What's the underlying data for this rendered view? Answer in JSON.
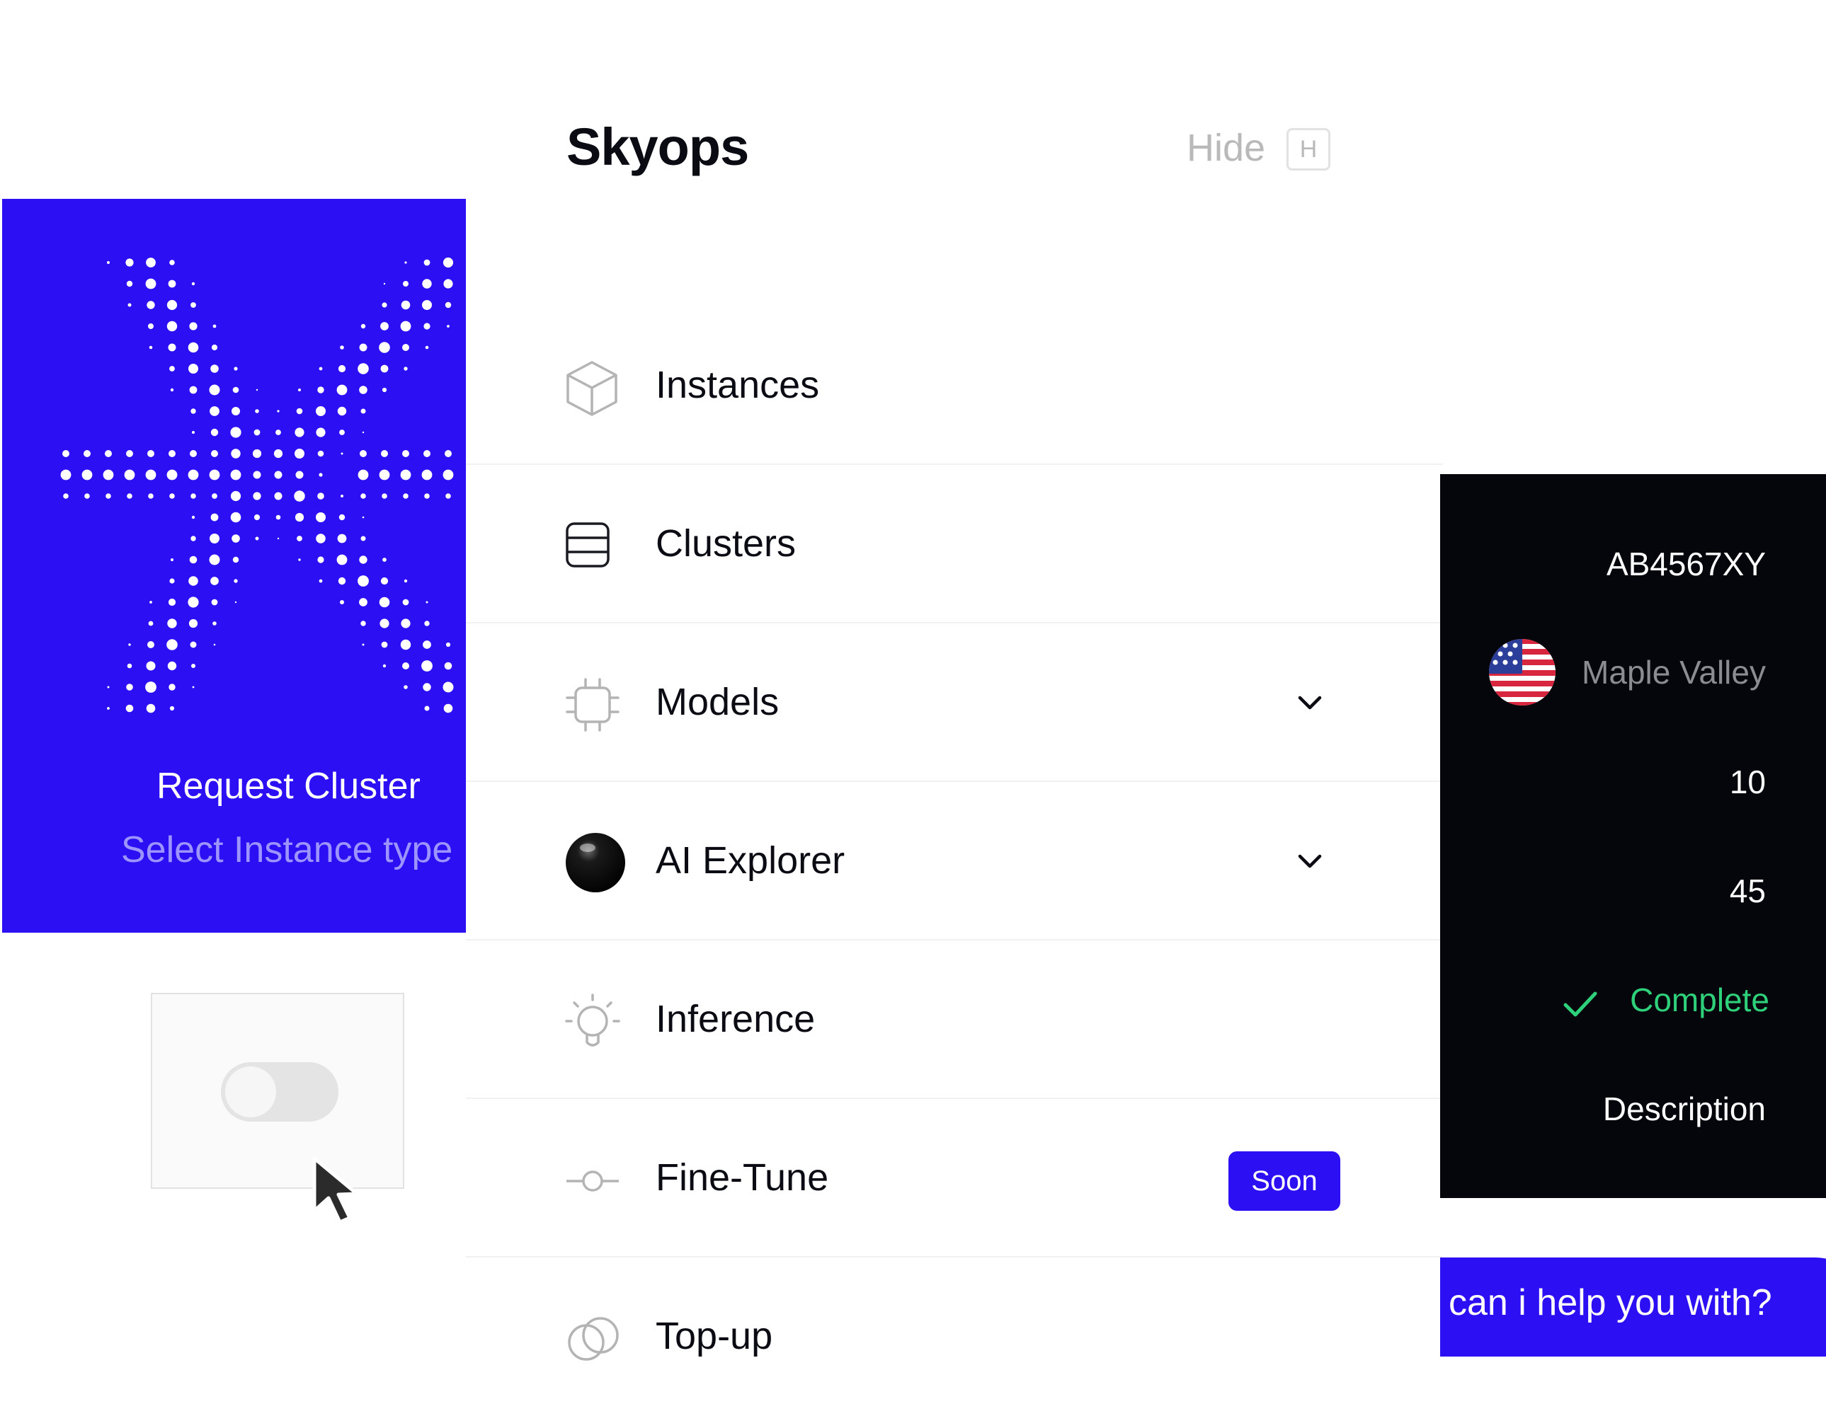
{
  "promo": {
    "title": "Request Cluster",
    "subtitle": "Select Instance type",
    "accent_color": "#2c0ff2",
    "logo_icon": "dotted-x-logo"
  },
  "toggle": {
    "state": "off"
  },
  "sidebar": {
    "brand": "Skyops",
    "hide_label": "Hide",
    "hide_shortcut": "H",
    "items": [
      {
        "label": "Instances",
        "icon": "cube-icon"
      },
      {
        "label": "Clusters",
        "icon": "database-icon"
      },
      {
        "label": "Models",
        "icon": "chip-icon",
        "expandable": true
      },
      {
        "label": "AI Explorer",
        "icon": "black-sphere-icon",
        "expandable": true
      },
      {
        "label": "Inference",
        "icon": "lightbulb-icon"
      },
      {
        "label": "Fine-Tune",
        "icon": "slider-icon",
        "badge": "Soon"
      },
      {
        "label": "Top-up",
        "icon": "coins-icon"
      }
    ]
  },
  "details": {
    "id": "AB4567XY",
    "location": "Maple Valley",
    "location_flag": "us-flag-icon",
    "value_1": "10",
    "value_2": "45",
    "status": "Complete",
    "status_color": "#2fd07a",
    "description_label": "Description"
  },
  "chat": {
    "text": "can i help you with?"
  }
}
